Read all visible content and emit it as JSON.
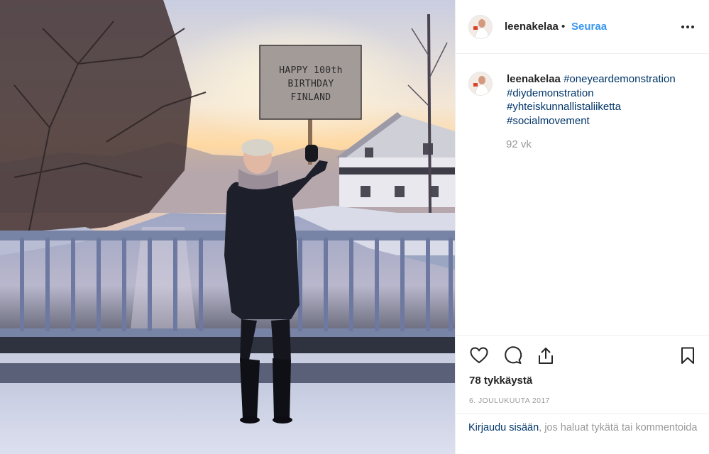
{
  "post": {
    "username": "leenakelaa",
    "separator": "•",
    "follow_label": "Seuraa",
    "more_icon": "more-options-icon",
    "sign_lines": [
      "HAPPY 100th",
      "BIRTHDAY",
      "FINLAND"
    ]
  },
  "caption": {
    "username": "leenakelaa",
    "hashtags": [
      "#oneyeardemonstration",
      "#diydemonstration",
      "#yhteiskunnallistaliiketta",
      "#socialmovement"
    ],
    "age": "92 vk"
  },
  "actions": {
    "icons": [
      "heart-icon",
      "comment-icon",
      "share-icon",
      "bookmark-icon"
    ],
    "likes": "78 tykkäystä",
    "date": "6. JOULUKUUTA 2017"
  },
  "login": {
    "link": "Kirjaudu sisään",
    "rest": ", jos haluat tykätä tai kommentoida"
  },
  "colors": {
    "link_blue": "#3897f0",
    "hashtag": "#003569",
    "muted": "#999999",
    "text": "#262626",
    "border": "#efefef"
  }
}
